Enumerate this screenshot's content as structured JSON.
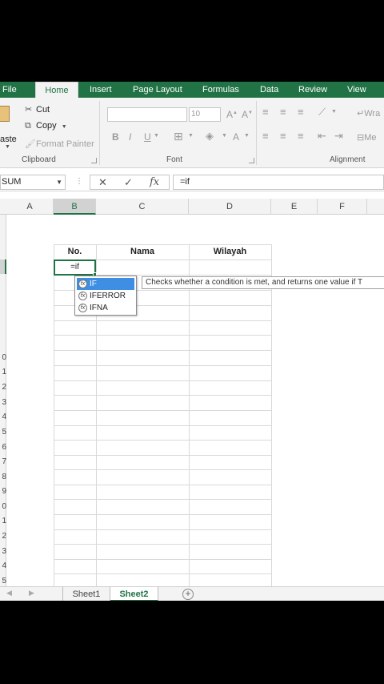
{
  "ribbon_tabs": [
    "File",
    "Home",
    "Insert",
    "Page Layout",
    "Formulas",
    "Data",
    "Review",
    "View"
  ],
  "active_tab": "Home",
  "clipboard": {
    "paste_label": "aste",
    "cut_label": "Cut",
    "copy_label": "Copy",
    "format_painter_label": "Format Painter",
    "group_label": "Clipboard"
  },
  "font": {
    "font_size": "10",
    "group_label": "Font"
  },
  "alignment": {
    "wrap_label": "Wra",
    "merge_label": "Me",
    "group_label": "Alignment"
  },
  "formula_bar": {
    "name_box": "SUM",
    "value": "=if"
  },
  "columns": [
    "A",
    "B",
    "C",
    "D",
    "E",
    "F"
  ],
  "row_numbers": [
    "0",
    "1",
    "2",
    "3",
    "4",
    "5",
    "6",
    "7",
    "8",
    "9",
    "0",
    "1",
    "2",
    "3",
    "4",
    "5"
  ],
  "table": {
    "headers": [
      "No.",
      "Nama",
      "Wilayah"
    ]
  },
  "active_cell": {
    "value": "=if"
  },
  "autocomplete": {
    "items": [
      "IF",
      "IFERROR",
      "IFNA"
    ],
    "selected": "IF",
    "tooltip": "Checks whether a condition is met, and returns one value if T"
  },
  "sheets": [
    "Sheet1",
    "Sheet2"
  ],
  "active_sheet": "Sheet2",
  "colors": {
    "excel_green": "#217346",
    "selection_blue": "#3e8ee3"
  }
}
